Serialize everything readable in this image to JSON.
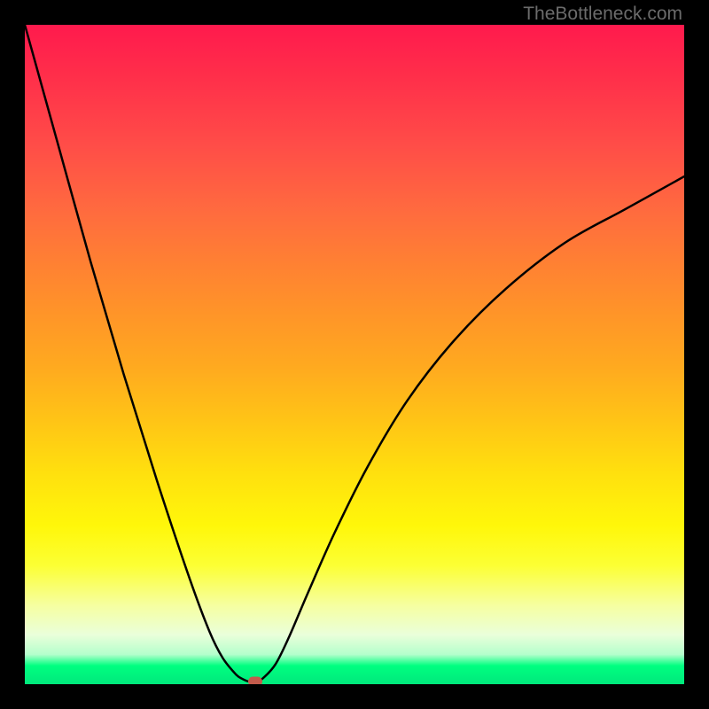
{
  "watermark": "TheBottleneck.com",
  "chart_data": {
    "type": "line",
    "title": "",
    "xlabel": "",
    "ylabel": "",
    "x_range": [
      0,
      100
    ],
    "y_range": [
      0,
      100
    ],
    "series": [
      {
        "name": "curve",
        "x": [
          0,
          5,
          10,
          15,
          20,
          25,
          28,
          30,
          32,
          33,
          34,
          35,
          36,
          38,
          40,
          43,
          47,
          52,
          58,
          65,
          73,
          82,
          91,
          100
        ],
        "values": [
          100,
          82,
          64,
          47,
          31,
          16,
          8,
          4,
          1.5,
          0.8,
          0.4,
          0.4,
          0.8,
          3,
          7,
          14,
          23,
          33,
          43,
          52,
          60,
          67,
          72,
          77
        ]
      }
    ],
    "marker": {
      "x": 35,
      "y": 0.4
    },
    "background_gradient": {
      "top": "#ff1a4d",
      "mid": "#ffe00e",
      "bottom": "#00e87c"
    }
  }
}
